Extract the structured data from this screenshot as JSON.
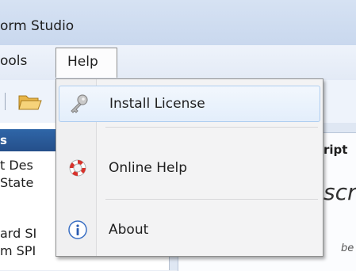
{
  "window": {
    "title": "orm Studio"
  },
  "menubar": {
    "tools_label": "ools",
    "help_label": "Help"
  },
  "left_panel": {
    "header": "s",
    "items": [
      "t Des",
      "State",
      "ard SI",
      "m SPI"
    ]
  },
  "right_panel": {
    "header": "ript",
    "italic_text": "scri",
    "small_text": "be"
  },
  "help_menu": {
    "items": [
      {
        "label": "Install License",
        "icon": "key-icon",
        "highlighted": true
      },
      {
        "label": "Online Help",
        "icon": "lifebuoy-icon"
      },
      {
        "label": "About",
        "icon": "info-icon"
      }
    ]
  },
  "colors": {
    "title_bar": "#d6e2f3",
    "panel_header": "#2f66a8",
    "menu_hover_border": "#aecdf0"
  }
}
